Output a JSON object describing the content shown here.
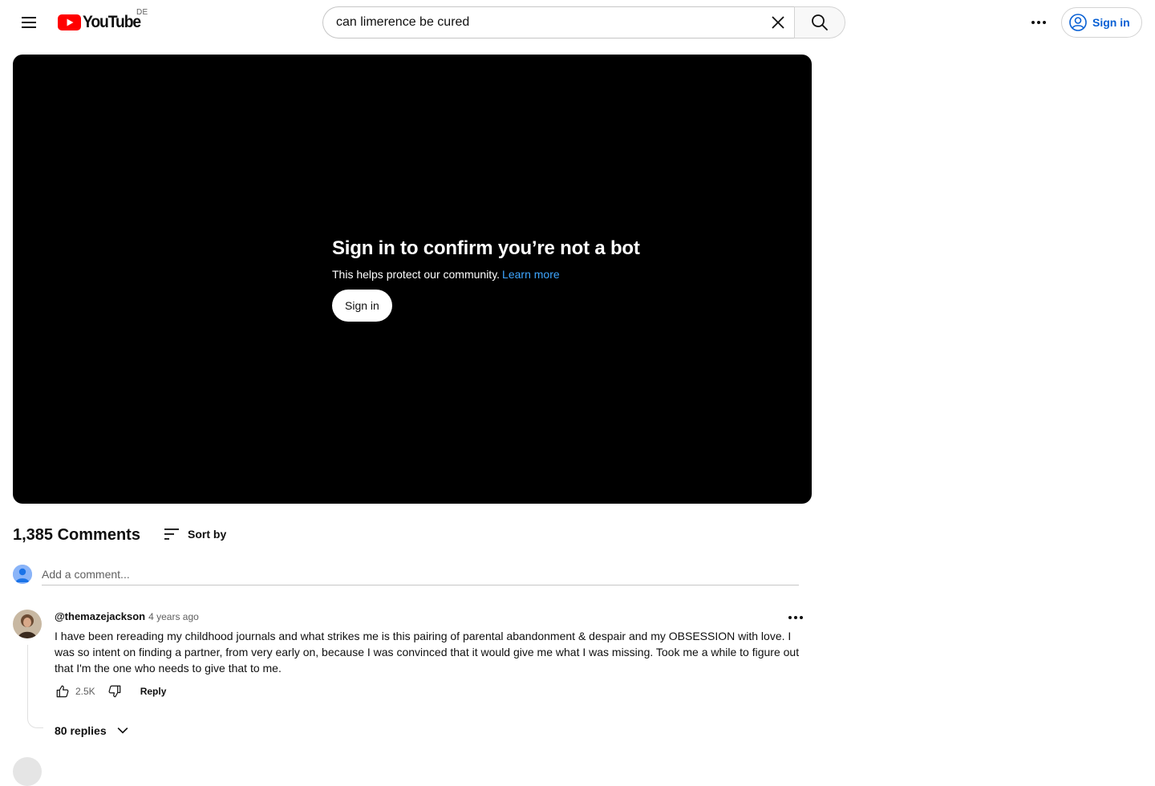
{
  "masthead": {
    "logo_text": "YouTube",
    "country_code": "DE",
    "search": {
      "value": "can limerence be cured",
      "placeholder": "Search"
    },
    "signin_label": "Sign in"
  },
  "player": {
    "title": "Sign in to confirm you’re not a bot",
    "subtitle": "This helps protect our community.",
    "learn_more": "Learn more",
    "signin_label": "Sign in"
  },
  "comments": {
    "count_label": "1,385 Comments",
    "sort_label": "Sort by",
    "add_placeholder": "Add a comment...",
    "items": [
      {
        "author": "@themazejackson",
        "time": "4 years ago",
        "text": "I have been rereading my childhood journals and what strikes me is this pairing of parental abandonment & despair and my OBSESSION with love. I was so intent on finding a partner, from very early on, because I was convinced that it would give me what I was missing. Took me a while to figure out that I'm the one who needs to give that to me.",
        "likes": "2.5K",
        "reply_label": "Reply",
        "replies_label": "80 replies"
      }
    ]
  },
  "colors": {
    "youtube_red": "#ff0000",
    "link_blue": "#065fd4",
    "player_link": "#3ea6ff"
  }
}
